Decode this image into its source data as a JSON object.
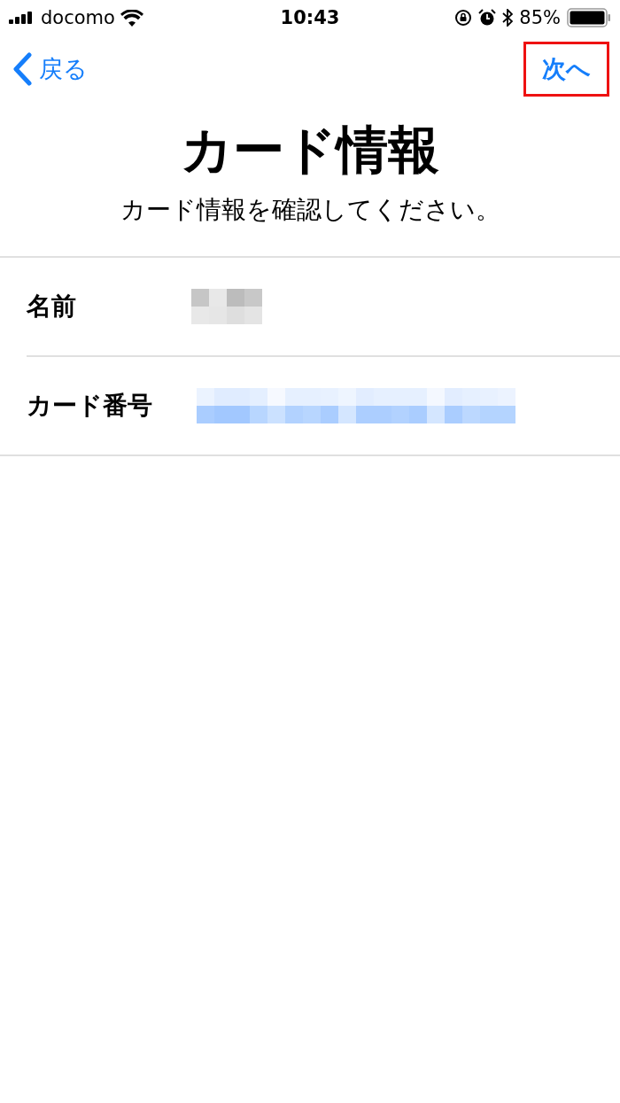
{
  "status_bar": {
    "carrier": "docomo",
    "time": "10:43",
    "battery": "85%"
  },
  "nav": {
    "back": "戻る",
    "next": {
      "label": "次へ",
      "highlighted": true
    }
  },
  "title": "カード情報",
  "subtitle": "カード情報を確認してください。",
  "rows": [
    {
      "label": "名前",
      "kind": "name"
    },
    {
      "label": "カード番号",
      "kind": "number"
    }
  ]
}
